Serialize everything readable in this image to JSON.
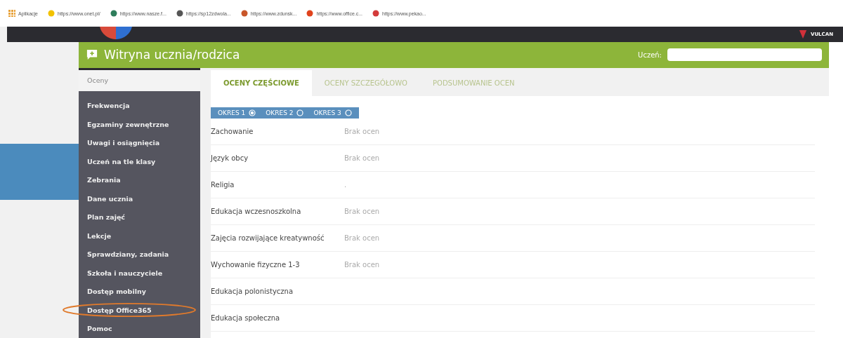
{
  "bookmarks": [
    {
      "label": "Aplikacje",
      "color": "#e8a23a"
    },
    {
      "label": "https://www.onet.pl/",
      "color": "#f2c200"
    },
    {
      "label": "https://www.nasze.f...",
      "color": "#2e7d5b"
    },
    {
      "label": "https://sp12zdwola...",
      "color": "#555555"
    },
    {
      "label": "https://www.zdunsk...",
      "color": "#c8562a"
    },
    {
      "label": "https://www.office.c...",
      "color": "#e0431d"
    },
    {
      "label": "https://www.pekao...",
      "color": "#d33b3b"
    }
  ],
  "brand": {
    "name": "VULCAN"
  },
  "header": {
    "title": "Witryna ucznia/rodzica",
    "student_label": "Uczeń:",
    "student_redacted": true
  },
  "sidebar": {
    "items": [
      {
        "label": "Oceny",
        "selected": true,
        "highlighted": false
      },
      {
        "label": "Frekwencja",
        "selected": false,
        "highlighted": false
      },
      {
        "label": "Egzaminy zewnętrzne",
        "selected": false,
        "highlighted": false
      },
      {
        "label": "Uwagi i osiągnięcia",
        "selected": false,
        "highlighted": false
      },
      {
        "label": "Uczeń na tle klasy",
        "selected": false,
        "highlighted": false
      },
      {
        "label": "Zebrania",
        "selected": false,
        "highlighted": false
      },
      {
        "label": "Dane ucznia",
        "selected": false,
        "highlighted": false
      },
      {
        "label": "Plan zajęć",
        "selected": false,
        "highlighted": false
      },
      {
        "label": "Lekcje",
        "selected": false,
        "highlighted": false
      },
      {
        "label": "Sprawdziany, zadania",
        "selected": false,
        "highlighted": false
      },
      {
        "label": "Szkoła i nauczyciele",
        "selected": false,
        "highlighted": false
      },
      {
        "label": "Dostęp mobilny",
        "selected": false,
        "highlighted": false
      },
      {
        "label": "Dostęp Office365",
        "selected": false,
        "highlighted": true
      },
      {
        "label": "Pomoc",
        "selected": false,
        "highlighted": false
      }
    ]
  },
  "tabs": [
    {
      "label": "OCENY CZĘŚCIOWE",
      "selected": true
    },
    {
      "label": "OCENY SZCZEGÓŁOWO",
      "selected": false
    },
    {
      "label": "PODSUMOWANIE OCEN",
      "selected": false
    }
  ],
  "periods": [
    {
      "label": "OKRES 1",
      "selected": true
    },
    {
      "label": "OKRES 2",
      "selected": false
    },
    {
      "label": "OKRES 3",
      "selected": false
    }
  ],
  "grades": [
    {
      "subject": "Zachowanie",
      "value": "Brak ocen"
    },
    {
      "subject": "Język obcy",
      "value": "Brak ocen"
    },
    {
      "subject": "Religia",
      "value": "."
    },
    {
      "subject": "Edukacja wczesnoszkolna",
      "value": "Brak ocen"
    },
    {
      "subject": "Zajęcia rozwijające kreatywność",
      "value": "Brak ocen"
    },
    {
      "subject": "Wychowanie fizyczne 1-3",
      "value": "Brak ocen"
    },
    {
      "subject": "Edukacja polonistyczna"
    },
    {
      "subject": "Edukacja społeczna"
    }
  ]
}
